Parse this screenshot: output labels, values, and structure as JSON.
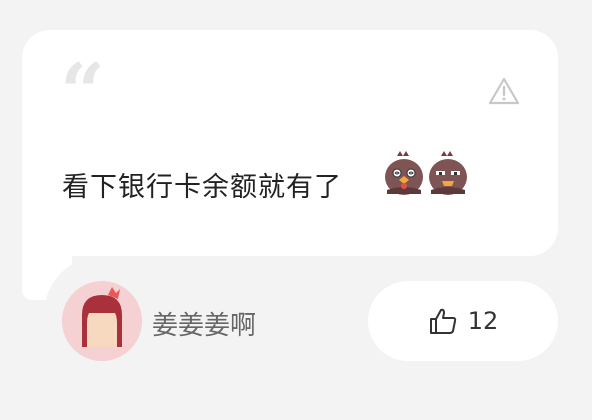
{
  "comment": {
    "text": "看下银行卡余额就有了",
    "quote_icon": "quote-mark-icon",
    "report_icon": "warning-triangle-icon",
    "emojis": [
      "chicken-dizzy-emoji",
      "chicken-sad-emoji"
    ]
  },
  "author": {
    "name": "姜姜姜啊",
    "avatar_icon": "girl-avatar"
  },
  "like": {
    "icon": "thumbs-up-icon",
    "count": "12"
  },
  "colors": {
    "background": "#f3f3f3",
    "card": "#ffffff",
    "text": "#222222",
    "username": "#666666",
    "avatar_bg": "#f5d1d3"
  }
}
